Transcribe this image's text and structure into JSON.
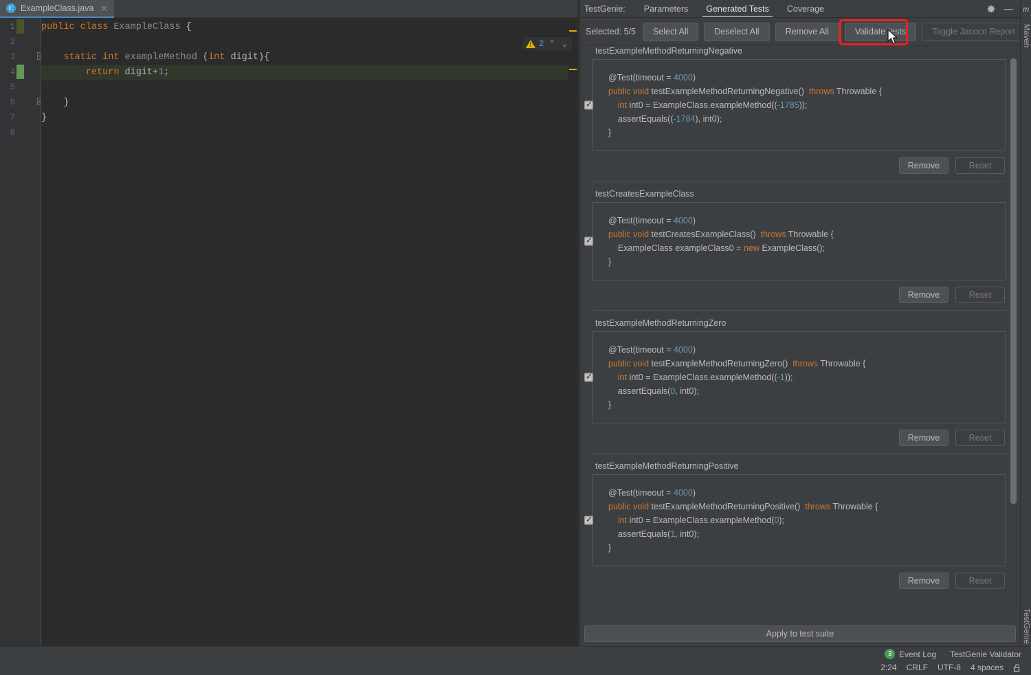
{
  "editor": {
    "tab": {
      "filename": "ExampleClass.java",
      "icon": "java-class-icon",
      "close": "✕"
    },
    "warnings": {
      "count": "2",
      "icon": "warning-triangle-icon",
      "symbol": "!"
    },
    "line_numbers": [
      "1",
      "2",
      "3",
      "4",
      "5",
      "6",
      "7",
      "8"
    ],
    "code_lines": [
      {
        "n": 1,
        "tokens": [
          {
            "t": "public ",
            "c": "kw"
          },
          {
            "t": "class ",
            "c": "kw"
          },
          {
            "t": "ExampleClass",
            "c": "dim"
          },
          {
            "t": " {",
            "c": "ident"
          }
        ],
        "state": "modified"
      },
      {
        "n": 2,
        "tokens": [],
        "state": "normal"
      },
      {
        "n": 3,
        "tokens": [
          {
            "t": "    static ",
            "c": "kw"
          },
          {
            "t": "int ",
            "c": "kw"
          },
          {
            "t": "exampleMethod",
            "c": "dim"
          },
          {
            "t": " (",
            "c": "ident"
          },
          {
            "t": "int",
            "c": "kw"
          },
          {
            "t": " digit){",
            "c": "ident"
          }
        ],
        "state": "normal"
      },
      {
        "n": 4,
        "tokens": [
          {
            "t": "        return",
            "c": "kw"
          },
          {
            "t": " digit+",
            "c": "ident"
          },
          {
            "t": "1",
            "c": "num"
          },
          {
            "t": ";",
            "c": "ident"
          }
        ],
        "state": "caret"
      },
      {
        "n": 5,
        "tokens": [],
        "state": "normal"
      },
      {
        "n": 6,
        "tokens": [
          {
            "t": "    }",
            "c": "ident"
          }
        ],
        "state": "normal"
      },
      {
        "n": 7,
        "tokens": [
          {
            "t": "}",
            "c": "ident"
          }
        ],
        "state": "normal"
      },
      {
        "n": 8,
        "tokens": [],
        "state": "normal"
      }
    ]
  },
  "tool_window": {
    "title": "TestGenie:",
    "tabs": [
      {
        "label": "Parameters",
        "active": false
      },
      {
        "label": "Generated Tests",
        "active": true
      },
      {
        "label": "Coverage",
        "active": false
      }
    ],
    "gear_icon": "gear-icon",
    "minimize_icon": "minimize-icon",
    "toolbar": {
      "selected_label": "Selected: 5/5",
      "select_all": "Select All",
      "deselect_all": "Deselect All",
      "remove_all": "Remove All",
      "validate_tests": "Validate tests",
      "toggle_jacoco": "Toggle Jacoco Report",
      "highlight_color": "#ee2020"
    },
    "apply_button": "Apply to test suite",
    "card_buttons": {
      "remove": "Remove",
      "reset": "Reset"
    }
  },
  "tests": [
    {
      "name": "testExampleMethodReturningNegative",
      "checked": true,
      "code": [
        [
          {
            "t": "@Test(timeout = ",
            "c": "tdef"
          },
          {
            "t": "4000",
            "c": "tnum"
          },
          {
            "t": ")",
            "c": "tdef"
          }
        ],
        [
          {
            "t": "public void ",
            "c": "tkw"
          },
          {
            "t": "testExampleMethodReturningNegative()  ",
            "c": "tdef"
          },
          {
            "t": "throws ",
            "c": "tkw"
          },
          {
            "t": "Throwable {",
            "c": "tdef"
          }
        ],
        [
          {
            "t": "    int",
            "c": "tkw"
          },
          {
            "t": " int0 = ExampleClass.exampleMethod((",
            "c": "tdef"
          },
          {
            "t": "-1785",
            "c": "tnum"
          },
          {
            "t": "));",
            "c": "tdef"
          }
        ],
        [
          {
            "t": "    assertEquals((",
            "c": "tdef"
          },
          {
            "t": "-1784",
            "c": "tnum"
          },
          {
            "t": "), int0);",
            "c": "tdef"
          }
        ],
        [
          {
            "t": "}",
            "c": "tdef"
          }
        ]
      ]
    },
    {
      "name": "testCreatesExampleClass",
      "checked": true,
      "code": [
        [
          {
            "t": "@Test(timeout = ",
            "c": "tdef"
          },
          {
            "t": "4000",
            "c": "tnum"
          },
          {
            "t": ")",
            "c": "tdef"
          }
        ],
        [
          {
            "t": "public void ",
            "c": "tkw"
          },
          {
            "t": "testCreatesExampleClass()  ",
            "c": "tdef"
          },
          {
            "t": "throws ",
            "c": "tkw"
          },
          {
            "t": "Throwable {",
            "c": "tdef"
          }
        ],
        [
          {
            "t": "    ExampleClass exampleClass0 = ",
            "c": "tdef"
          },
          {
            "t": "new ",
            "c": "tkw"
          },
          {
            "t": "ExampleClass();",
            "c": "tdef"
          }
        ],
        [
          {
            "t": "}",
            "c": "tdef"
          }
        ]
      ]
    },
    {
      "name": "testExampleMethodReturningZero",
      "checked": true,
      "code": [
        [
          {
            "t": "@Test(timeout = ",
            "c": "tdef"
          },
          {
            "t": "4000",
            "c": "tnum"
          },
          {
            "t": ")",
            "c": "tdef"
          }
        ],
        [
          {
            "t": "public void ",
            "c": "tkw"
          },
          {
            "t": "testExampleMethodReturningZero()  ",
            "c": "tdef"
          },
          {
            "t": "throws ",
            "c": "tkw"
          },
          {
            "t": "Throwable {",
            "c": "tdef"
          }
        ],
        [
          {
            "t": "    int",
            "c": "tkw"
          },
          {
            "t": " int0 = ExampleClass.exampleMethod((",
            "c": "tdef"
          },
          {
            "t": "-1",
            "c": "tnum"
          },
          {
            "t": "));",
            "c": "tdef"
          }
        ],
        [
          {
            "t": "    assertEquals(",
            "c": "tdef"
          },
          {
            "t": "0",
            "c": "tnum"
          },
          {
            "t": ", int0);",
            "c": "tdef"
          }
        ],
        [
          {
            "t": "}",
            "c": "tdef"
          }
        ]
      ]
    },
    {
      "name": "testExampleMethodReturningPositive",
      "checked": true,
      "code": [
        [
          {
            "t": "@Test(timeout = ",
            "c": "tdef"
          },
          {
            "t": "4000",
            "c": "tnum"
          },
          {
            "t": ")",
            "c": "tdef"
          }
        ],
        [
          {
            "t": "public void ",
            "c": "tkw"
          },
          {
            "t": "testExampleMethodReturningPositive()  ",
            "c": "tdef"
          },
          {
            "t": "throws ",
            "c": "tkw"
          },
          {
            "t": "Throwable {",
            "c": "tdef"
          }
        ],
        [
          {
            "t": "    int",
            "c": "tkw"
          },
          {
            "t": " int0 = ExampleClass.exampleMethod(",
            "c": "tdef"
          },
          {
            "t": "0",
            "c": "tnum"
          },
          {
            "t": ");",
            "c": "tdef"
          }
        ],
        [
          {
            "t": "    assertEquals(",
            "c": "tdef"
          },
          {
            "t": "1",
            "c": "tnum"
          },
          {
            "t": ", int0);",
            "c": "tdef"
          }
        ],
        [
          {
            "t": "}",
            "c": "tdef"
          }
        ]
      ]
    }
  ],
  "side_bars": {
    "top_right": "Maven",
    "bottom_right": "TestGenie",
    "maven_icon": "maven-m-icon"
  },
  "status_bar": {
    "event_log": "Event Log",
    "event_count": "3",
    "validator": "TestGenie Validator",
    "caret_position": "2:24",
    "line_separator": "CRLF",
    "encoding": "UTF-8",
    "indent": "4 spaces",
    "lock_icon": "unlocked-padlock-icon"
  }
}
